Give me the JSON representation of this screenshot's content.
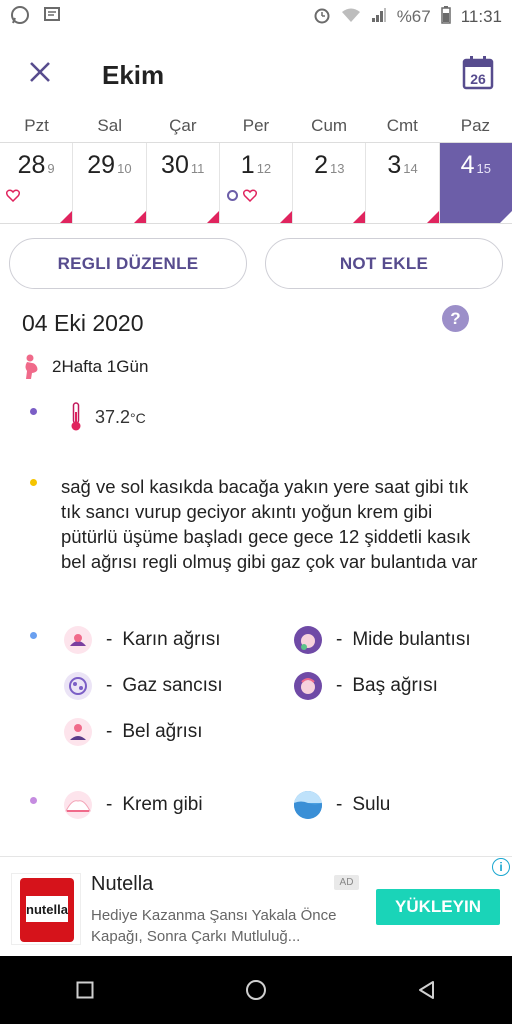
{
  "status_bar": {
    "battery": "%67",
    "time": "11:31",
    "icons": [
      "whatsapp-icon",
      "message-icon",
      "alarm-icon",
      "wifi-icon",
      "signal-icon",
      "battery-icon"
    ]
  },
  "header": {
    "title": "Ekim",
    "calendar_day": "26",
    "accent_color": "#574c8e"
  },
  "week": {
    "days": [
      "Pzt",
      "Sal",
      "Çar",
      "Per",
      "Cum",
      "Cmt",
      "Paz"
    ],
    "dates": [
      {
        "day": "28",
        "cycle": "9",
        "marks": [
          "heart"
        ]
      },
      {
        "day": "29",
        "cycle": "10",
        "marks": []
      },
      {
        "day": "30",
        "cycle": "11",
        "marks": []
      },
      {
        "day": "1",
        "cycle": "12",
        "marks": [
          "ring",
          "heart"
        ]
      },
      {
        "day": "2",
        "cycle": "13",
        "marks": []
      },
      {
        "day": "3",
        "cycle": "14",
        "marks": []
      },
      {
        "day": "4",
        "cycle": "15",
        "marks": []
      }
    ],
    "selected_color": "#6c5ea8",
    "period_color": "#e0245e"
  },
  "actions": {
    "edit_period": "REGLI DÜZENLE",
    "add_note": "NOT EKLE"
  },
  "detail": {
    "date": "04 Eki 2020",
    "help": "?",
    "pregnancy": "2Hafta 1Gün",
    "temperature": "37.2",
    "temperature_unit": "°C",
    "note": "sağ ve sol kasıkda bacağa yakın yere saat gibi tık tık sancı vurup geciyor akıntı yoğun krem gibi pütürlü üşüme başladı gece gece 12 şiddetli kasık bel ağrısı regli olmuş gibi gaz çok var bulantıda var",
    "dash": "-",
    "symptoms": [
      {
        "label": "Karın ağrısı",
        "icon": "cramps-icon"
      },
      {
        "label": "Mide bulantısı",
        "icon": "nausea-icon"
      },
      {
        "label": "Gaz sancısı",
        "icon": "gas-icon"
      },
      {
        "label": "Baş ağrısı",
        "icon": "headache-icon"
      },
      {
        "label": "Bel ağrısı",
        "icon": "backache-icon"
      }
    ],
    "discharge": [
      {
        "label": "Krem gibi",
        "icon": "creamy-icon"
      },
      {
        "label": "Sulu",
        "icon": "watery-icon"
      }
    ]
  },
  "ad": {
    "title": "Nutella",
    "badge": "AD",
    "description": "Hediye Kazanma Şansı Yakala Önce Kapağı, Sonra Çarkı Mutluluğ...",
    "cta": "YÜKLEYIN",
    "logo_text": "nutella",
    "info": "i"
  }
}
